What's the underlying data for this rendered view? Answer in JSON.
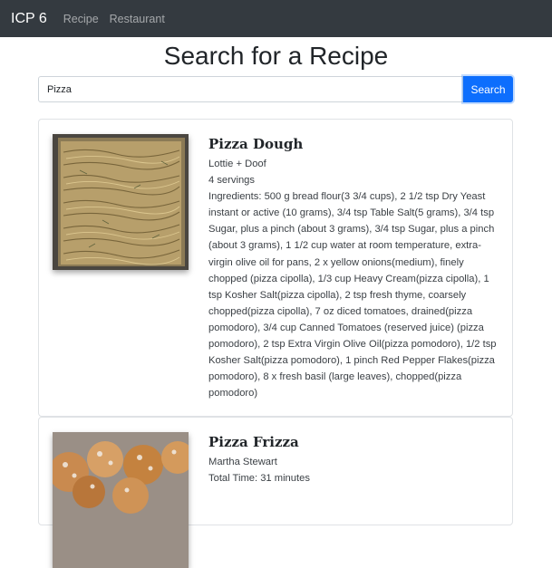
{
  "navbar": {
    "brand": "ICP 6",
    "links": [
      "Recipe",
      "Restaurant"
    ]
  },
  "page": {
    "title": "Search for a Recipe"
  },
  "search": {
    "value": "Pizza",
    "button_label": "Search"
  },
  "recipes": [
    {
      "title": "Pizza Dough",
      "source": "Lottie + Doof",
      "servings": "4 servings",
      "ingredients": "Ingredients: 500 g bread flour(3 3/4 cups), 2 1/2 tsp Dry Yeast instant or active (10 grams), 3/4 tsp Table Salt(5 grams), 3/4 tsp Sugar, plus a pinch (about 3 grams), 3/4 tsp Sugar, plus a pinch (about 3 grams), 1 1/2 cup water at room temperature, extra-virgin olive oil for pans, 2 x yellow onions(medium), finely chopped (pizza cipolla), 1/3 cup Heavy Cream(pizza cipolla), 1 tsp Kosher Salt(pizza cipolla), 2 tsp fresh thyme, coarsely chopped(pizza cipolla), 7 oz diced tomatoes, drained(pizza pomodoro), 3/4 cup Canned Tomatoes (reserved juice) (pizza pomodoro), 2 tsp Extra Virgin Olive Oil(pizza pomodoro), 1/2 tsp Kosher Salt(pizza pomodoro), 1 pinch Red Pepper Flakes(pizza pomodoro), 8 x fresh basil (large leaves), chopped(pizza pomodoro)"
    },
    {
      "title": "Pizza Frizza",
      "source": "Martha Stewart",
      "total_time": "Total Time: 31 minutes"
    }
  ]
}
